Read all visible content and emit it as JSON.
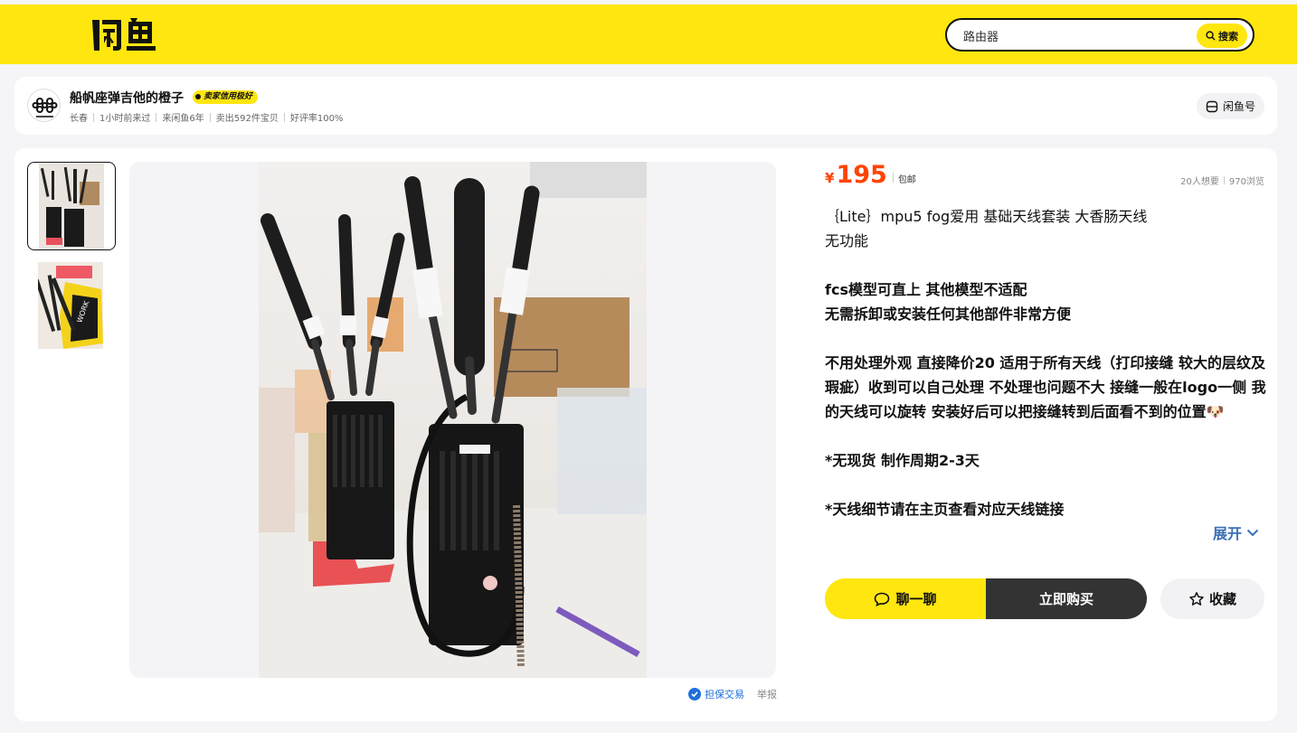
{
  "header": {
    "logo_alt": "闲鱼",
    "search": {
      "value": "路由器",
      "button_label": "搜索"
    },
    "brand_color": "#ffe60f"
  },
  "seller": {
    "name": "船帆座弹吉他的橙子",
    "badge": "卖家信用极好",
    "meta": [
      "长春",
      "1小时前来过",
      "来闲鱼6年",
      "卖出592件宝贝",
      "好评率100%"
    ],
    "xianyu_id_label": "闲鱼号"
  },
  "gallery": {
    "thumbnails": [
      {
        "name": "thumbnail-radios",
        "active": true
      },
      {
        "name": "thumbnail-antennas",
        "active": false
      }
    ]
  },
  "product": {
    "currency": "¥",
    "price": "195",
    "shipping": "包邮",
    "wants": "20人想要",
    "views": "970浏览",
    "price_color": "#ff4400",
    "description": [
      {
        "text": "｛Lite｝mpu5 fog爱用 基础天线套装 大香肠天线"
      },
      {
        "text": "无功能"
      },
      {
        "text": ""
      },
      {
        "text": "fcs模型可直上 其他模型不适配",
        "bold": true
      },
      {
        "text": "无需拆卸或安装任何其他部件非常方便",
        "bold": true
      },
      {
        "text": ""
      },
      {
        "text": "不用处理外观 直接降价20 适用于所有天线（打印接缝 较大的层纹及瑕疵）收到可以自己处理 不处理也问题不大 接缝一般在logo一侧 我的天线可以旋转 安装好后可以把接缝转到后面看不到的位置🐶",
        "bold": true
      },
      {
        "text": ""
      },
      {
        "text": "*无现货 制作周期2-3天",
        "bold": true
      },
      {
        "text": ""
      },
      {
        "text": "*天线细节请在主页查看对应天线链接",
        "bold": true
      }
    ],
    "expand_label": "展开"
  },
  "actions": {
    "chat_label": "聊一聊",
    "buy_label": "立即购买",
    "favorite_label": "收藏"
  },
  "footer": {
    "guarantee_label": "担保交易",
    "report_label": "举报"
  }
}
